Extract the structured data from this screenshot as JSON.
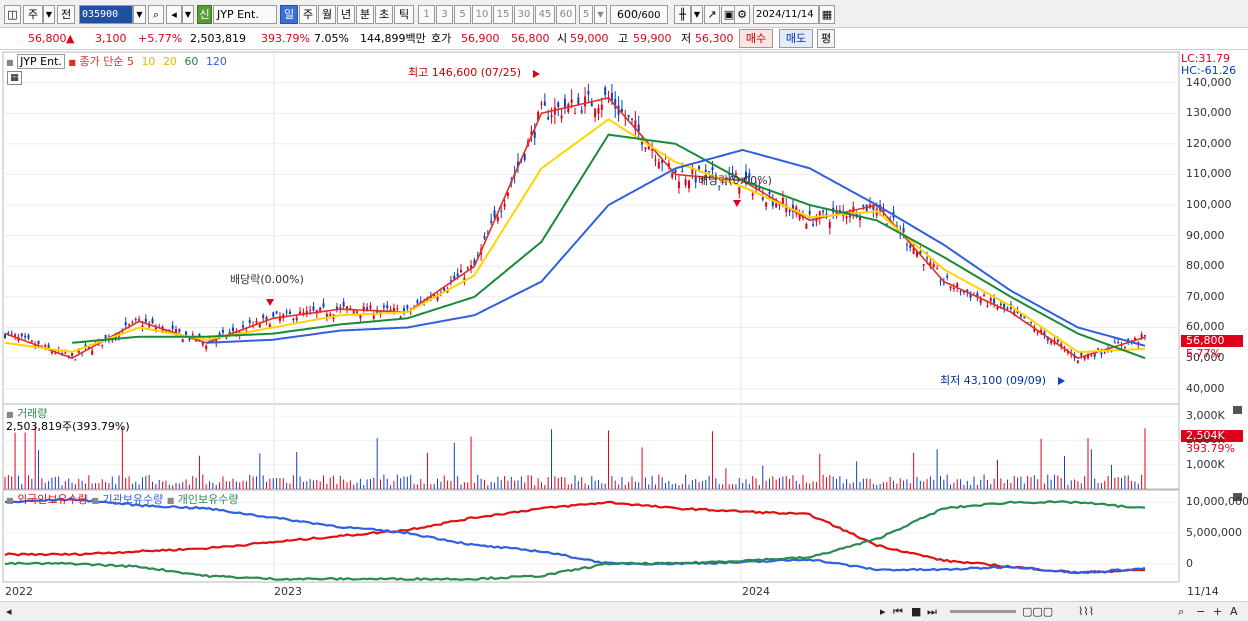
{
  "toolbar": {
    "period_main": "주",
    "jeon": "전",
    "stock_code": "035900",
    "sin_badge": "신",
    "stock_name": "JYP Ent.",
    "periods": [
      "일",
      "주",
      "월",
      "년",
      "분",
      "초",
      "틱"
    ],
    "minute_options": [
      "1",
      "3",
      "5",
      "10",
      "15",
      "30",
      "45",
      "60"
    ],
    "count_value": "5",
    "view_count": "600",
    "view_total": "/600",
    "date": "2024/11/14"
  },
  "quote": {
    "price": "56,800",
    "change_arrow": "▲",
    "change": "3,100",
    "change_pct": "+5.77%",
    "volume": "2,503,819",
    "volume_ratio": "393.79%",
    "turnover": "7.05%",
    "amount": "144,899백만",
    "hoga_label": "호가",
    "ask": "56,900",
    "bid": "56,800",
    "open_label": "시",
    "open": "59,000",
    "high_label": "고",
    "high": "59,900",
    "low_label": "저",
    "low": "56,300",
    "buy_button": "매수",
    "sell_button": "매도",
    "eval_button": "평"
  },
  "price_panel": {
    "stock_tag": "JYP Ent.",
    "legend_prefix": "종가 단순",
    "ma_labels": [
      "5",
      "10",
      "20",
      "60",
      "120"
    ],
    "lc": "LC:31.79",
    "hc": "HC:-61.26",
    "y_ticks": [
      "140,000",
      "130,000",
      "120,000",
      "110,000",
      "100,000",
      "90,000",
      "80,000",
      "70,000",
      "60,000",
      "50,000",
      "40,000"
    ],
    "current_price_tag": "56,800",
    "current_pct_tag": "5.77%",
    "annotations": {
      "high": "최고 146,600 (07/25)",
      "low": "최저 43,100 (09/09)",
      "dividend1": "배당락(0.00%)",
      "dividend2": "배당락(0.00%)"
    }
  },
  "volume_panel": {
    "title": "거래량",
    "value": "2,503,819주(393.79%)",
    "y_ticks": [
      "3,000K",
      "2,000K",
      "1,000K"
    ],
    "current_tag": "2,504K",
    "pct_tag": "393.79%"
  },
  "holding_panel": {
    "legend": [
      "외국인보유수량",
      "기관보유수량",
      "개인보유수량"
    ],
    "y_ticks": [
      "10,000,000",
      "5,000,000",
      "0"
    ]
  },
  "x_axis": {
    "labels": [
      "2022",
      "2023",
      "2024"
    ],
    "right_label": "11/14"
  },
  "colors": {
    "ma5": "#e03020",
    "ma10": "#ffd400",
    "ma20": "#ffd400",
    "ma60": "#1a8a3a",
    "ma120": "#3060e0",
    "candle_up": "#e0001a",
    "candle_down": "#1040c0",
    "foreign": "#e01010",
    "institution": "#3060e0",
    "individual": "#2a8a50"
  },
  "chart_data": {
    "type": "candlestick",
    "title": "JYP Ent. 종가 단순",
    "price_axis_range": [
      35000,
      150000
    ],
    "volume_axis_range": [
      0,
      3500000
    ],
    "holding_axis_range": [
      -3000000,
      12000000
    ],
    "x": [
      "2022-01",
      "2022-03",
      "2022-05",
      "2022-07",
      "2022-09",
      "2022-11",
      "2023-01",
      "2023-03",
      "2023-05",
      "2023-07",
      "2023-09",
      "2023-11",
      "2024-01",
      "2024-03",
      "2024-05",
      "2024-07",
      "2024-09",
      "2024-11"
    ],
    "series": [
      {
        "name": "종가",
        "values": [
          58000,
          50000,
          62000,
          55000,
          63000,
          66000,
          65000,
          80000,
          130000,
          135000,
          110000,
          108000,
          95000,
          100000,
          75000,
          65000,
          50000,
          56800
        ]
      },
      {
        "name": "5",
        "values": [
          58000,
          50000,
          62000,
          55000,
          63000,
          66000,
          65000,
          80000,
          130000,
          135000,
          110000,
          108000,
          95000,
          100000,
          75000,
          65000,
          50000,
          56800
        ]
      },
      {
        "name": "20",
        "values": [
          55000,
          52000,
          60000,
          56000,
          60000,
          64000,
          65000,
          77000,
          112000,
          128000,
          114000,
          106000,
          96000,
          98000,
          79000,
          67000,
          52000,
          53000
        ]
      },
      {
        "name": "60",
        "values": [
          null,
          55000,
          57000,
          57000,
          58000,
          61000,
          63000,
          70000,
          88000,
          123000,
          120000,
          108000,
          100000,
          95000,
          83000,
          70000,
          58000,
          50000
        ]
      },
      {
        "name": "120",
        "values": [
          null,
          null,
          null,
          55000,
          56000,
          59000,
          60000,
          64000,
          75000,
          100000,
          112000,
          118000,
          112000,
          100000,
          87000,
          72000,
          60000,
          54000
        ]
      }
    ],
    "holdings": [
      {
        "name": "외국인보유수량",
        "values": [
          1500000,
          1500000,
          2000000,
          2500000,
          3500000,
          4500000,
          5500000,
          7500000,
          9000000,
          10000000,
          9000000,
          8500000,
          8000000,
          3000000,
          500000,
          -500000,
          -1500000,
          -1000000
        ]
      },
      {
        "name": "기관보유수량",
        "values": [
          10000000,
          10500000,
          9500000,
          9000000,
          7500000,
          6000000,
          5000000,
          3000000,
          2000000,
          0,
          0,
          200000,
          700000,
          -1000000,
          -1000000,
          -500000,
          -1500000,
          -800000
        ]
      },
      {
        "name": "개인보유수량",
        "values": [
          0,
          0,
          -500000,
          -2000000,
          -2500000,
          -2500000,
          -2500000,
          -2500000,
          -2000000,
          0,
          0,
          500000,
          1000000,
          4000000,
          9000000,
          10000000,
          10000000,
          9000000
        ]
      }
    ]
  }
}
